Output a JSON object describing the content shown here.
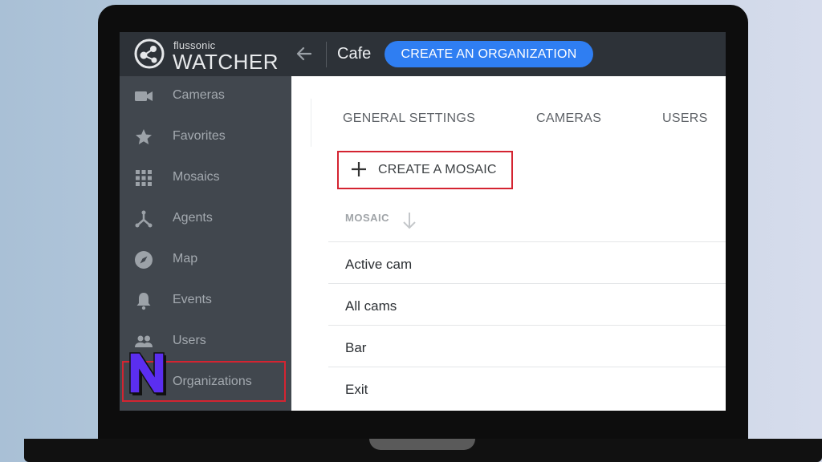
{
  "app": {
    "logo_small": "flussonic",
    "logo_big": "WATCHER",
    "organization": "Cafe",
    "create_org_label": "CREATE AN ORGANIZATION"
  },
  "sidebar": {
    "items": [
      {
        "label": "Cameras",
        "icon": "camera-icon"
      },
      {
        "label": "Favorites",
        "icon": "star-icon"
      },
      {
        "label": "Mosaics",
        "icon": "grid-icon"
      },
      {
        "label": "Agents",
        "icon": "agents-icon"
      },
      {
        "label": "Map",
        "icon": "compass-icon"
      },
      {
        "label": "Events",
        "icon": "bell-icon"
      },
      {
        "label": "Users",
        "icon": "users-icon"
      },
      {
        "label": "Organizations",
        "icon": "organization-icon"
      }
    ]
  },
  "main": {
    "tabs": [
      {
        "label": "GENERAL SETTINGS"
      },
      {
        "label": "CAMERAS"
      },
      {
        "label": "USERS"
      }
    ],
    "create_mosaic_label": "CREATE A MOSAIC",
    "column_header": "MOSAIC",
    "mosaics": [
      "Active cam",
      "All cams",
      "Bar",
      "Exit"
    ]
  },
  "colors": {
    "topbar": "#2d3238",
    "sidebar": "#41474e",
    "accent_blue": "#2f7ef2",
    "highlight_red": "#d42431",
    "badge_purple": "#5b2ef0"
  }
}
